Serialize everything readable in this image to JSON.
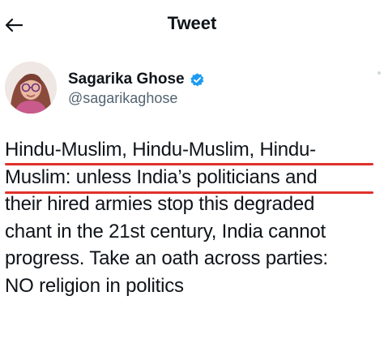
{
  "header": {
    "title": "Tweet",
    "back_icon": "arrow-left-icon"
  },
  "author": {
    "name": "Sagarika Ghose",
    "handle": "@sagarikaghose",
    "verified_icon": "verified-badge-icon",
    "verified_color": "#1d9bf0"
  },
  "tweet": {
    "lines": [
      "Hindu-Muslim, Hindu-Muslim, Hindu-",
      "Muslim: unless India’s politicians and",
      "their hired armies stop this degraded",
      "chant in the 21st century, India cannot",
      "progress. Take an oath across parties:",
      "NO religion in politics"
    ],
    "highlight_color": "#e0312b"
  }
}
